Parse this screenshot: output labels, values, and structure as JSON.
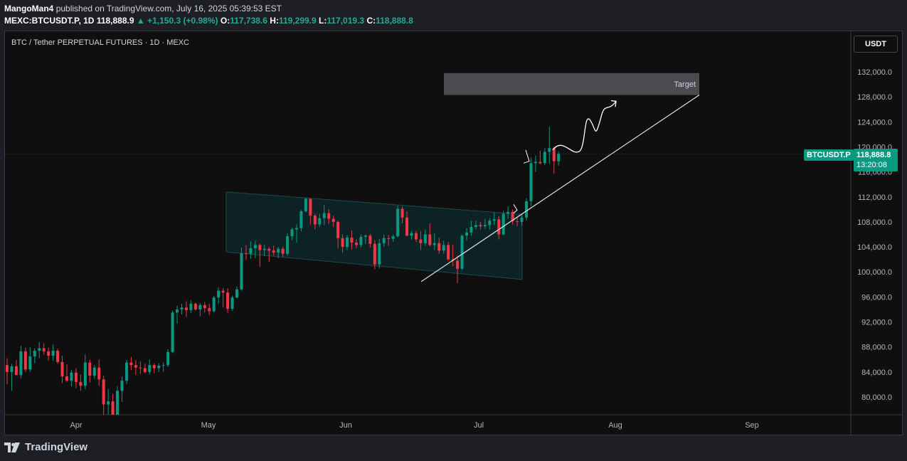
{
  "header": {
    "author": "MangoMan4",
    "published": "published on TradingView.com, July 16, 2025 05:39:53 EST",
    "symbol": "MEXC:BTCUSDT.P, 1D",
    "last": "118,888.9",
    "change": "▲ +1,150.3 (+0.98%)",
    "o_label": "O:",
    "o": "117,738.6",
    "h_label": "H:",
    "h": "119,299.9",
    "l_label": "L:",
    "l": "117,019.3",
    "c_label": "C:",
    "c": "118,888.8"
  },
  "pane_title": "BTC / Tether PERPETUAL FUTURES · 1D · MEXC",
  "currency_button": "USDT",
  "price_tag": {
    "symbol": "BTCUSDT.P",
    "price": "118,888.8",
    "countdown": "13:20:08"
  },
  "footer": {
    "brand": "TradingView"
  },
  "colors": {
    "up": "#089981",
    "down": "#f23645",
    "background": "#0f0f10",
    "channel": "#0e2a2c"
  },
  "chart_data": {
    "type": "candlestick",
    "title": "BTC / Tether PERPETUAL FUTURES · 1D · MEXC",
    "ylim": [
      77000,
      135000
    ],
    "y_ticks": [
      "132,000.0",
      "128,000.0",
      "124,000.0",
      "120,000.0",
      "116,000.0",
      "112,000.0",
      "108,000.0",
      "104,000.0",
      "100,000.0",
      "96,000.0",
      "92,000.0",
      "88,000.0",
      "84,000.0",
      "80,000.0"
    ],
    "x_ticks": [
      "Apr",
      "May",
      "Jun",
      "Jul",
      "Aug",
      "Sep"
    ],
    "annotation": "Target",
    "target_zone": [
      128300,
      131800
    ],
    "candles_ohlc": [
      [
        85100,
        86200,
        82000,
        84000
      ],
      [
        84000,
        85300,
        81000,
        84900
      ],
      [
        84900,
        85900,
        83800,
        83500
      ],
      [
        83500,
        88200,
        83000,
        87300
      ],
      [
        87300,
        87900,
        84000,
        84400
      ],
      [
        84400,
        88000,
        84000,
        86500
      ],
      [
        86500,
        87800,
        85400,
        87400
      ],
      [
        87400,
        88800,
        86200,
        87800
      ],
      [
        87800,
        88600,
        86800,
        87300
      ],
      [
        87300,
        87900,
        85800,
        86600
      ],
      [
        86600,
        88400,
        85800,
        87400
      ],
      [
        87400,
        87700,
        85300,
        85600
      ],
      [
        85600,
        86600,
        82200,
        83300
      ],
      [
        83300,
        85200,
        82400,
        82600
      ],
      [
        82600,
        84300,
        81700,
        83900
      ],
      [
        83900,
        84600,
        81400,
        82400
      ],
      [
        82400,
        83600,
        81000,
        81800
      ],
      [
        81800,
        86800,
        81200,
        85500
      ],
      [
        85500,
        86000,
        82300,
        83400
      ],
      [
        83400,
        85100,
        82900,
        84700
      ],
      [
        84700,
        86000,
        81800,
        82800
      ],
      [
        82800,
        83400,
        76800,
        78800
      ],
      [
        78800,
        81300,
        76600,
        79300
      ],
      [
        79300,
        80500,
        74600,
        76300
      ],
      [
        76300,
        81700,
        75900,
        81000
      ],
      [
        81000,
        83300,
        79200,
        82600
      ],
      [
        82600,
        85900,
        82100,
        85500
      ],
      [
        85500,
        86400,
        84300,
        85100
      ],
      [
        85100,
        85900,
        83500,
        84700
      ],
      [
        84700,
        85700,
        83700,
        84600
      ],
      [
        84600,
        85300,
        83800,
        84000
      ],
      [
        84000,
        86000,
        83600,
        85100
      ],
      [
        85100,
        85400,
        83800,
        84600
      ],
      [
        84600,
        85400,
        84000,
        85000
      ],
      [
        85000,
        85500,
        84000,
        85100
      ],
      [
        85100,
        87600,
        84800,
        87200
      ],
      [
        87200,
        93800,
        87000,
        93500
      ],
      [
        93500,
        94600,
        91700,
        94000
      ],
      [
        94000,
        94900,
        93200,
        94300
      ],
      [
        94300,
        95300,
        92800,
        93900
      ],
      [
        93900,
        95500,
        93400,
        94900
      ],
      [
        94900,
        95100,
        93800,
        94000
      ],
      [
        94000,
        95000,
        92900,
        94700
      ],
      [
        94700,
        95200,
        93500,
        94200
      ],
      [
        94200,
        94900,
        93100,
        93700
      ],
      [
        93700,
        96200,
        93500,
        95900
      ],
      [
        95900,
        97500,
        94900,
        97000
      ],
      [
        97000,
        97400,
        94300,
        96700
      ],
      [
        96700,
        97400,
        93400,
        94100
      ],
      [
        94100,
        96200,
        93800,
        95900
      ],
      [
        95900,
        97700,
        95800,
        97200
      ],
      [
        97200,
        103900,
        97000,
        103000
      ],
      [
        103000,
        104300,
        101900,
        102900
      ],
      [
        102900,
        104900,
        102100,
        103800
      ],
      [
        103800,
        105000,
        102200,
        104300
      ],
      [
        104300,
        104500,
        100800,
        103500
      ],
      [
        103500,
        104400,
        102500,
        103700
      ],
      [
        103700,
        104000,
        101600,
        103400
      ],
      [
        103400,
        104200,
        102600,
        103100
      ],
      [
        103100,
        104000,
        102200,
        103700
      ],
      [
        103700,
        104000,
        102400,
        102900
      ],
      [
        102900,
        106200,
        102600,
        105700
      ],
      [
        105700,
        107100,
        105100,
        106800
      ],
      [
        106800,
        107600,
        104700,
        107000
      ],
      [
        107000,
        109900,
        106500,
        109700
      ],
      [
        109700,
        111900,
        109500,
        111700
      ],
      [
        111700,
        111600,
        107600,
        109000
      ],
      [
        109000,
        109300,
        106800,
        107600
      ],
      [
        107600,
        109300,
        107200,
        108600
      ],
      [
        108600,
        110700,
        107500,
        109400
      ],
      [
        109400,
        110000,
        107700,
        108500
      ],
      [
        108500,
        109000,
        107200,
        108000
      ],
      [
        108000,
        108200,
        103800,
        105400
      ],
      [
        105400,
        106000,
        103100,
        104000
      ],
      [
        104000,
        105900,
        103500,
        105500
      ],
      [
        105500,
        106600,
        103600,
        104700
      ],
      [
        104700,
        105200,
        103800,
        104300
      ],
      [
        104300,
        106000,
        103900,
        105600
      ],
      [
        105600,
        106000,
        104500,
        105800
      ],
      [
        105800,
        106100,
        103900,
        104500
      ],
      [
        104500,
        105100,
        100400,
        101200
      ],
      [
        101200,
        105300,
        100600,
        104600
      ],
      [
        104600,
        106000,
        104000,
        105400
      ],
      [
        105400,
        105900,
        104200,
        105300
      ],
      [
        105300,
        106000,
        104800,
        105700
      ],
      [
        105700,
        110600,
        105500,
        110100
      ],
      [
        110100,
        110500,
        107800,
        108700
      ],
      [
        108700,
        109700,
        105700,
        105800
      ],
      [
        105800,
        106500,
        105200,
        106200
      ],
      [
        106200,
        106600,
        104800,
        105200
      ],
      [
        105200,
        106500,
        103500,
        104600
      ],
      [
        104600,
        106800,
        104200,
        106000
      ],
      [
        106000,
        107800,
        104100,
        104300
      ],
      [
        104300,
        106200,
        103500,
        104600
      ],
      [
        104600,
        105500,
        102900,
        103400
      ],
      [
        103400,
        105000,
        102900,
        104300
      ],
      [
        104300,
        104800,
        101800,
        102000
      ],
      [
        102000,
        104400,
        100900,
        101800
      ],
      [
        101800,
        102600,
        98200,
        100500
      ],
      [
        100500,
        106000,
        100300,
        105800
      ],
      [
        105800,
        107000,
        105000,
        106300
      ],
      [
        106300,
        108200,
        105800,
        107200
      ],
      [
        107200,
        108200,
        106800,
        107500
      ],
      [
        107500,
        108000,
        106800,
        107300
      ],
      [
        107300,
        108500,
        106900,
        107500
      ],
      [
        107500,
        108600,
        106800,
        108200
      ],
      [
        108200,
        109500,
        107500,
        108400
      ],
      [
        108400,
        108900,
        105200,
        106000
      ],
      [
        106000,
        109800,
        105900,
        109300
      ],
      [
        109300,
        110500,
        108500,
        109600
      ],
      [
        109600,
        110000,
        107600,
        108100
      ],
      [
        108100,
        108700,
        107300,
        108000
      ],
      [
        108000,
        109100,
        107400,
        108700
      ],
      [
        108700,
        111800,
        108200,
        111300
      ],
      [
        111300,
        118300,
        110500,
        117400
      ],
      [
        117400,
        118600,
        116000,
        117600
      ],
      [
        117600,
        119400,
        117200,
        117400
      ],
      [
        117400,
        119800,
        117100,
        119200
      ],
      [
        119200,
        123200,
        117300,
        119800
      ],
      [
        119800,
        120000,
        115700,
        117700
      ],
      [
        117700,
        119300,
        117000,
        118900
      ]
    ]
  }
}
